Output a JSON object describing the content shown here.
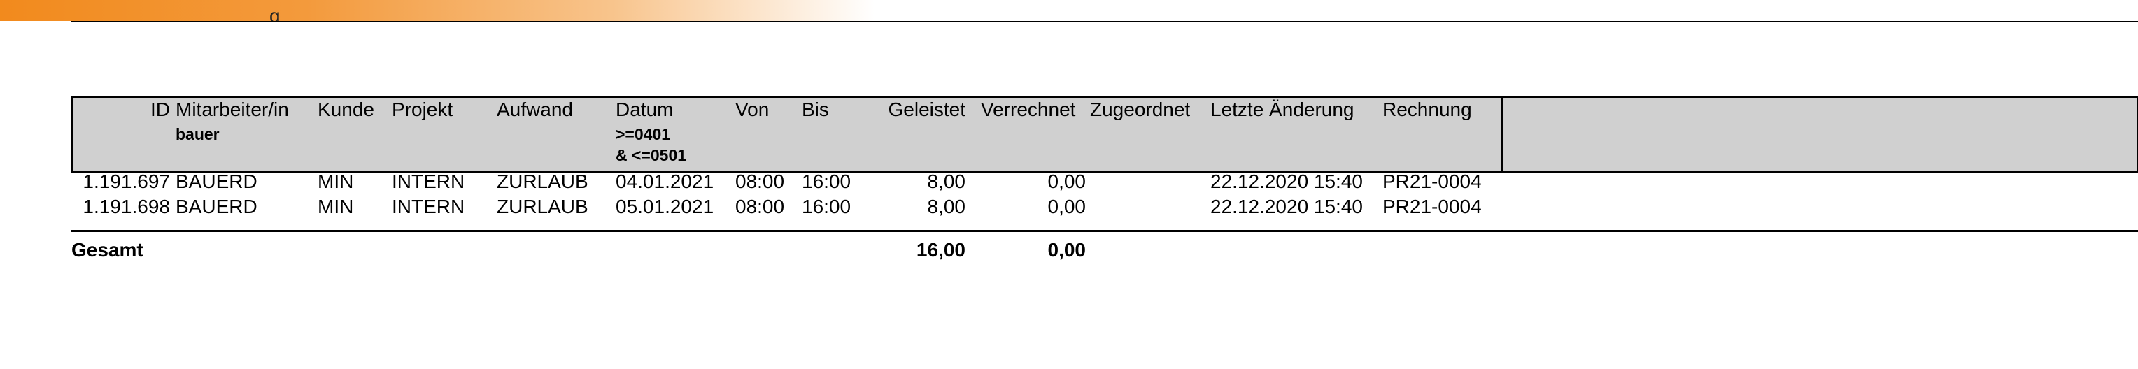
{
  "header": {
    "columns": {
      "id": "ID",
      "employee": "Mitarbeiter/in",
      "customer": "Kunde",
      "project": "Projekt",
      "effort": "Aufwand",
      "date": "Datum",
      "from": "Von",
      "to": "Bis",
      "performed": "Geleistet",
      "billed": "Verrechnet",
      "assigned": "Zugeordnet",
      "last_change": "Letzte Änderung",
      "invoice": "Rechnung"
    },
    "filters": {
      "employee": "bauer",
      "date_line1": ">=0401",
      "date_line2": "& <=0501"
    }
  },
  "rows": [
    {
      "id": "1.191.697",
      "employee": "BAUERD",
      "customer": "MIN",
      "project": "INTERN",
      "effort": "ZURLAUB",
      "date": "04.01.2021",
      "from": "08:00",
      "to": "16:00",
      "performed": "8,00",
      "billed": "0,00",
      "assigned": "",
      "last_change": "22.12.2020 15:40",
      "invoice": "PR21-0004"
    },
    {
      "id": "1.191.698",
      "employee": "BAUERD",
      "customer": "MIN",
      "project": "INTERN",
      "effort": "ZURLAUB",
      "date": "05.01.2021",
      "from": "08:00",
      "to": "16:00",
      "performed": "8,00",
      "billed": "0,00",
      "assigned": "",
      "last_change": "22.12.2020 15:40",
      "invoice": "PR21-0004"
    }
  ],
  "totals": {
    "label": "Gesamt",
    "performed": "16,00",
    "billed": "0,00"
  },
  "colors": {
    "accent_orange": "#f28a1d",
    "header_gray": "#d0d0d0"
  }
}
